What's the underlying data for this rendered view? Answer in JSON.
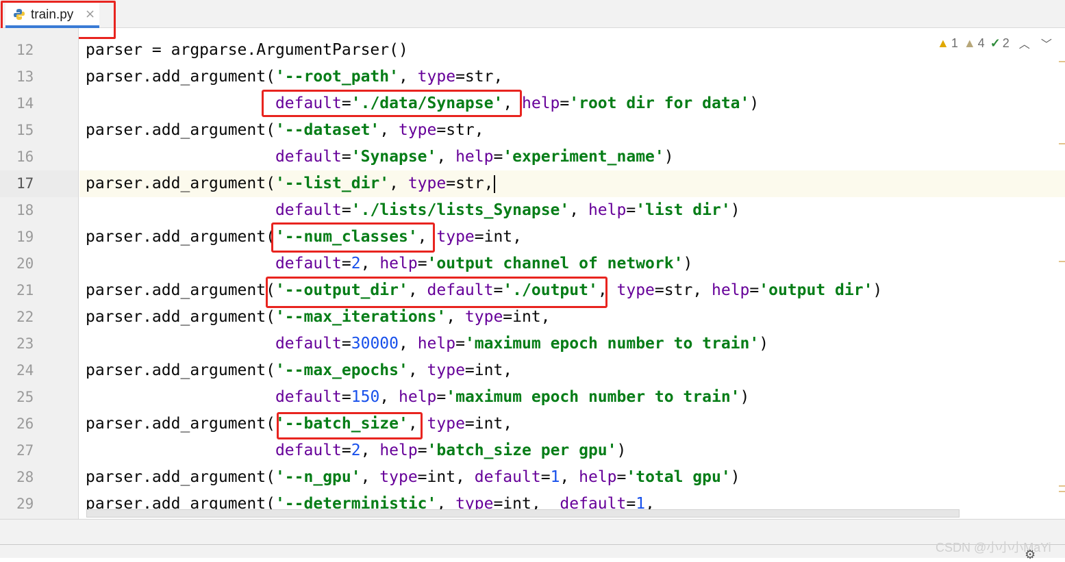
{
  "tab": {
    "file_name": "train.py",
    "close_glyph": "×"
  },
  "inspections": {
    "errors": "1",
    "warnings": "4",
    "ok": "2"
  },
  "gutter": {
    "current_line": 17,
    "lines": [
      "12",
      "13",
      "14",
      "15",
      "16",
      "17",
      "18",
      "19",
      "20",
      "21",
      "22",
      "23",
      "24",
      "25",
      "26",
      "27",
      "28",
      "29"
    ]
  },
  "code": [
    [
      [
        "t",
        "parser = argparse.ArgumentParser()"
      ]
    ],
    [
      [
        "t",
        "parser.add_argument("
      ],
      [
        "s",
        "'--root_path'"
      ],
      [
        "t",
        ", "
      ],
      [
        "k",
        "type"
      ],
      [
        "t",
        "=str,"
      ]
    ],
    [
      [
        "t",
        "                    "
      ],
      [
        "k",
        "default"
      ],
      [
        "t",
        "="
      ],
      [
        "s",
        "'./data/Synapse'"
      ],
      [
        "t",
        ", "
      ],
      [
        "k",
        "help"
      ],
      [
        "t",
        "="
      ],
      [
        "s",
        "'root dir for data'"
      ],
      [
        "t",
        ")"
      ]
    ],
    [
      [
        "t",
        "parser.add_argument("
      ],
      [
        "s",
        "'--dataset'"
      ],
      [
        "t",
        ", "
      ],
      [
        "k",
        "type"
      ],
      [
        "t",
        "=str,"
      ]
    ],
    [
      [
        "t",
        "                    "
      ],
      [
        "k",
        "default"
      ],
      [
        "t",
        "="
      ],
      [
        "s",
        "'Synapse'"
      ],
      [
        "t",
        ", "
      ],
      [
        "k",
        "help"
      ],
      [
        "t",
        "="
      ],
      [
        "s",
        "'experiment_name'"
      ],
      [
        "t",
        ")"
      ]
    ],
    [
      [
        "t",
        "parser.add_argument("
      ],
      [
        "s",
        "'--list_dir'"
      ],
      [
        "t",
        ", "
      ],
      [
        "k",
        "type"
      ],
      [
        "t",
        "=str,"
      ]
    ],
    [
      [
        "t",
        "                    "
      ],
      [
        "k",
        "default"
      ],
      [
        "t",
        "="
      ],
      [
        "s",
        "'./lists/lists_Synapse'"
      ],
      [
        "t",
        ", "
      ],
      [
        "k",
        "help"
      ],
      [
        "t",
        "="
      ],
      [
        "s",
        "'list dir'"
      ],
      [
        "t",
        ")"
      ]
    ],
    [
      [
        "t",
        "parser.add_argument("
      ],
      [
        "s",
        "'--num_classes'"
      ],
      [
        "t",
        ", "
      ],
      [
        "k",
        "type"
      ],
      [
        "t",
        "=int,"
      ]
    ],
    [
      [
        "t",
        "                    "
      ],
      [
        "k",
        "default"
      ],
      [
        "t",
        "="
      ],
      [
        "n",
        "2"
      ],
      [
        "t",
        ", "
      ],
      [
        "k",
        "help"
      ],
      [
        "t",
        "="
      ],
      [
        "s",
        "'output channel of network'"
      ],
      [
        "t",
        ")"
      ]
    ],
    [
      [
        "t",
        "parser.add_argument("
      ],
      [
        "s",
        "'--output_dir'"
      ],
      [
        "t",
        ", "
      ],
      [
        "k",
        "default"
      ],
      [
        "t",
        "="
      ],
      [
        "s",
        "'./output'"
      ],
      [
        "t",
        ", "
      ],
      [
        "k",
        "type"
      ],
      [
        "t",
        "=str, "
      ],
      [
        "k",
        "help"
      ],
      [
        "t",
        "="
      ],
      [
        "s",
        "'output dir'"
      ],
      [
        "t",
        ")"
      ]
    ],
    [
      [
        "t",
        "parser.add_argument("
      ],
      [
        "s",
        "'--max_iterations'"
      ],
      [
        "t",
        ", "
      ],
      [
        "k",
        "type"
      ],
      [
        "t",
        "=int,"
      ]
    ],
    [
      [
        "t",
        "                    "
      ],
      [
        "k",
        "default"
      ],
      [
        "t",
        "="
      ],
      [
        "n",
        "30000"
      ],
      [
        "t",
        ", "
      ],
      [
        "k",
        "help"
      ],
      [
        "t",
        "="
      ],
      [
        "s",
        "'maximum epoch number to train'"
      ],
      [
        "t",
        ")"
      ]
    ],
    [
      [
        "t",
        "parser.add_argument("
      ],
      [
        "s",
        "'--max_epochs'"
      ],
      [
        "t",
        ", "
      ],
      [
        "k",
        "type"
      ],
      [
        "t",
        "=int,"
      ]
    ],
    [
      [
        "t",
        "                    "
      ],
      [
        "k",
        "default"
      ],
      [
        "t",
        "="
      ],
      [
        "n",
        "150"
      ],
      [
        "t",
        ", "
      ],
      [
        "k",
        "help"
      ],
      [
        "t",
        "="
      ],
      [
        "s",
        "'maximum epoch number to train'"
      ],
      [
        "t",
        ")"
      ]
    ],
    [
      [
        "t",
        "parser.add_argument("
      ],
      [
        "s",
        "'--batch_size'"
      ],
      [
        "t",
        ", "
      ],
      [
        "k",
        "type"
      ],
      [
        "t",
        "=int,"
      ]
    ],
    [
      [
        "t",
        "                    "
      ],
      [
        "k",
        "default"
      ],
      [
        "t",
        "="
      ],
      [
        "n",
        "2"
      ],
      [
        "t",
        ", "
      ],
      [
        "k",
        "help"
      ],
      [
        "t",
        "="
      ],
      [
        "s",
        "'batch_size per gpu'"
      ],
      [
        "t",
        ")"
      ]
    ],
    [
      [
        "t",
        "parser.add_argument("
      ],
      [
        "s",
        "'--n_gpu'"
      ],
      [
        "t",
        ", "
      ],
      [
        "k",
        "type"
      ],
      [
        "t",
        "=int, "
      ],
      [
        "k",
        "default"
      ],
      [
        "t",
        "="
      ],
      [
        "n",
        "1"
      ],
      [
        "t",
        ", "
      ],
      [
        "k",
        "help"
      ],
      [
        "t",
        "="
      ],
      [
        "s",
        "'total gpu'"
      ],
      [
        "t",
        ")"
      ]
    ],
    [
      [
        "t",
        "parser.add_argument("
      ],
      [
        "s",
        "'--deterministic'"
      ],
      [
        "t",
        ", "
      ],
      [
        "k",
        "type"
      ],
      [
        "t",
        "=int,  "
      ],
      [
        "k",
        "default"
      ],
      [
        "t",
        "="
      ],
      [
        "n",
        "1"
      ],
      [
        "t",
        ","
      ]
    ]
  ],
  "watermark": "CSDN @小小小MaYi",
  "colors": {
    "string": "#067d17",
    "keyword_arg": "#660099",
    "number": "#1750eb",
    "highlight_box": "#e8241f",
    "tab_underline": "#3a7bd5"
  }
}
